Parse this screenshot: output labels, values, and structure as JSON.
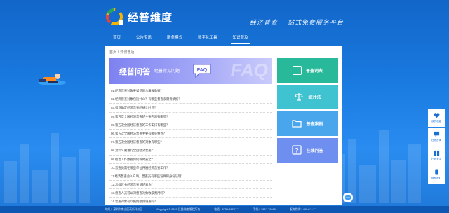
{
  "header": {
    "brand": "经普维度",
    "slogan": "经济普查 一站式免费服务平台"
  },
  "nav": [
    {
      "label": "首页",
      "active": false
    },
    {
      "label": "公告资讯",
      "active": false
    },
    {
      "label": "服务模式",
      "active": false
    },
    {
      "label": "数字化工具",
      "active": false
    },
    {
      "label": "知识普及",
      "active": true
    }
  ],
  "breadcrumb": {
    "home": "首页",
    "separator": "/",
    "current": "知识普及"
  },
  "banner": {
    "title": "经普问答",
    "subtitle": "经普常见问题",
    "badge": "FAQ",
    "watermark": "FAQ"
  },
  "questions": [
    "01.经济普查对象要如何配合填报数据？",
    "02.经济普查对象包括什么？有哪些普查表需要填报？",
    "03.如何确定经济普查的统计时点？",
    "04.第五次全国经济普查的主要内容有哪些？",
    "05.第五次全国经济普查的工作安排有哪些？",
    "06.第五次全国经济普查主要有哪些特点？",
    "07.第五次全国经济普查的对象有哪些？",
    "08.为什么要进行全国经济普查？",
    "09.经普工作数据如何保障安全？",
    "10.普查员需在哪些单位开展经济普查工作？",
    "11.经济普查会入户吗，普查员有哪些证件和身份证明？",
    "12.怎样区分经济普查员的真伪？",
    "13.普查人员可以对普查对象收取费用吗？",
    "14.普查对象可以拒绝接受调查吗？"
  ],
  "cards": [
    {
      "label": "普查词典",
      "icon": "dictionary-icon",
      "color": "#28b99a"
    },
    {
      "label": "统计法",
      "icon": "scales-icon",
      "color": "#3fc3d1"
    },
    {
      "label": "普查案例",
      "icon": "folder-icon",
      "color": "#4aa6ec"
    },
    {
      "label": "在线问答",
      "icon": "question-icon",
      "color": "#6e8ff0"
    }
  ],
  "sidebar": [
    {
      "label": "我的收藏",
      "icon": "heart-icon"
    },
    {
      "label": "在线咨询",
      "icon": "chat-icon"
    },
    {
      "label": "扫码关注",
      "icon": "grid-icon"
    },
    {
      "label": "联系我们",
      "icon": "phone-icon"
    }
  ],
  "footer": {
    "address": "地址：深圳市南山区高新科技园",
    "copyright": "Copyright © 2023 经普维度 版权所有",
    "phone1": "电话：0755-2678****",
    "phone2": "手机：158****0000",
    "hotline": "服务热线：400-8**-***"
  },
  "colors": {
    "background": "#1a7be0",
    "banner": "#7e82f0",
    "footer": "#0d57b3"
  }
}
